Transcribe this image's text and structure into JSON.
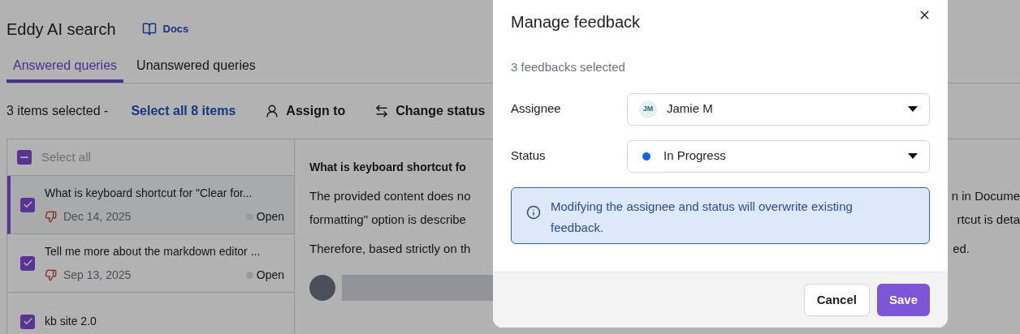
{
  "page": {
    "title": "Eddy AI search",
    "docs_link": "Docs"
  },
  "tabs": [
    {
      "label": "Answered queries",
      "selected": true
    },
    {
      "label": "Unanswered queries",
      "selected": false
    }
  ],
  "selection_bar": {
    "summary": "3 items selected -",
    "select_all_link": "Select all 8 items",
    "actions": [
      {
        "kind": "assign",
        "label": "Assign to"
      },
      {
        "kind": "status",
        "label": "Change status"
      }
    ]
  },
  "list": {
    "select_all": {
      "label": "Select all",
      "indeterminate": true
    },
    "items": [
      {
        "title": "What is keyboard shortcut for \"Clear for...",
        "date": "Dec 14, 2025",
        "status": "Open",
        "color": "#9a9a9a",
        "checked": true,
        "selected": true
      },
      {
        "title": "Tell me more about the markdown editor ...",
        "date": "Sep 13, 2025",
        "status": "Open",
        "color": "#9a9a9a",
        "checked": true,
        "selected": false
      },
      {
        "title": "kb site 2.0",
        "checked": true,
        "selected": false
      }
    ]
  },
  "detail": {
    "question": "What is keyboard shortcut fo",
    "paragraphs": [
      {
        "lines": [
          {
            "start": "The provided content does no",
            "end": "n in Docume"
          },
          {
            "start": "formatting\" option is describe",
            "end": "rtcut is deta"
          }
        ]
      },
      {
        "lines": [
          {
            "start": "Therefore, based strictly on th",
            "end": "ed."
          }
        ]
      }
    ]
  },
  "modal": {
    "title": "Manage feedback",
    "subtitle": "3 feedbacks selected",
    "fields": [
      {
        "label": "Assignee",
        "kind": "person",
        "initials": "JM",
        "value": "Jamie M"
      },
      {
        "label": "Status",
        "kind": "status",
        "value": "In Progress",
        "color": "#0b63f6"
      }
    ],
    "notice": "Modifying the assignee and status will overwrite existing feedback.",
    "buttons": [
      {
        "label": "Cancel",
        "kind": "secondary"
      },
      {
        "label": "Save",
        "kind": "primary"
      }
    ]
  }
}
